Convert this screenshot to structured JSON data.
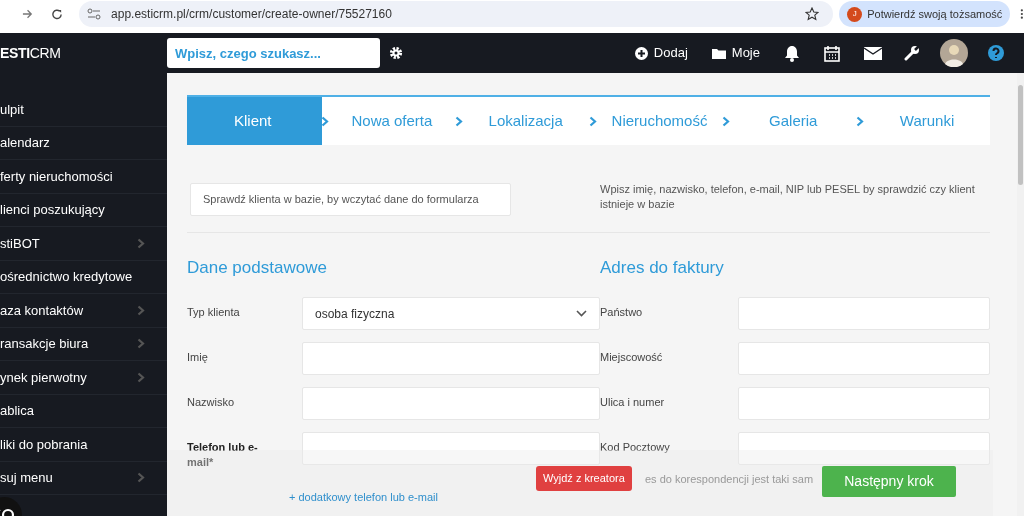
{
  "browser": {
    "url": "app.esticrm.pl/crm/customer/create-owner/75527160",
    "profile_prompt": "Potwierdź swoją tożsamość",
    "profile_initial": "J"
  },
  "logo": {
    "brand_bold": "ESTI",
    "brand_light": "CRM"
  },
  "topbar": {
    "search_placeholder": "Wpisz, czego szukasz...",
    "actions": [
      {
        "kind": "add",
        "label": "Dodaj"
      },
      {
        "kind": "folder",
        "label": "Moje"
      }
    ]
  },
  "sidebar": {
    "items": [
      {
        "label": "ulpit",
        "expandable": false
      },
      {
        "label": "alendarz",
        "expandable": false
      },
      {
        "label": "ferty nieruchomości",
        "expandable": false
      },
      {
        "label": "lienci poszukujący",
        "expandable": false
      },
      {
        "label": "stiBOT",
        "expandable": true
      },
      {
        "label": "ośrednictwo kredytowe",
        "expandable": false
      },
      {
        "label": "aza kontaktów",
        "expandable": true
      },
      {
        "label": "ransakcje biura",
        "expandable": true
      },
      {
        "label": "ynek pierwotny",
        "expandable": true
      },
      {
        "label": "ablica",
        "expandable": false
      },
      {
        "label": "liki do pobrania",
        "expandable": false
      },
      {
        "label": "suj menu",
        "expandable": true
      }
    ]
  },
  "wizard": {
    "steps": [
      {
        "label": "Klient",
        "selected": true
      },
      {
        "label": "Nowa oferta",
        "selected": false
      },
      {
        "label": "Lokalizacja",
        "selected": false
      },
      {
        "label": "Nieruchomość",
        "selected": false
      },
      {
        "label": "Galeria",
        "selected": false
      },
      {
        "label": "Warunki",
        "selected": false
      }
    ]
  },
  "lookup": {
    "placeholder": "Sprawdź klienta w bazie, by wczytać dane do formularza",
    "hint": "Wpisz imię, nazwisko, telefon, e-mail, NIP lub PESEL by sprawdzić czy klient istnieje w bazie"
  },
  "sections": [
    {
      "title": "Dane podstawowe",
      "fields": [
        {
          "label": "Typ klienta",
          "kind": "select",
          "value": "osoba fizyczna",
          "required": false
        },
        {
          "label": "Imię",
          "kind": "text",
          "required": false
        },
        {
          "label": "Nazwisko",
          "kind": "text",
          "required": false
        },
        {
          "label": "Telefon lub e-mail*",
          "kind": "text",
          "required": true
        }
      ]
    },
    {
      "title": "Adres do faktury",
      "fields": [
        {
          "label": "Państwo",
          "kind": "text",
          "required": false
        },
        {
          "label": "Miejscowość",
          "kind": "text",
          "required": false
        },
        {
          "label": "Ulica i numer",
          "kind": "text",
          "required": false
        },
        {
          "label": "Kod Pocztowy",
          "kind": "text",
          "required": false
        }
      ]
    }
  ],
  "extra_contact_link": "+ dodatkowy telefon lub e-mail",
  "same_address_note": "es do korespondencji jest taki sam",
  "buttons": {
    "exit": "Wyjdź z kreatora",
    "next": "Następny krok"
  }
}
